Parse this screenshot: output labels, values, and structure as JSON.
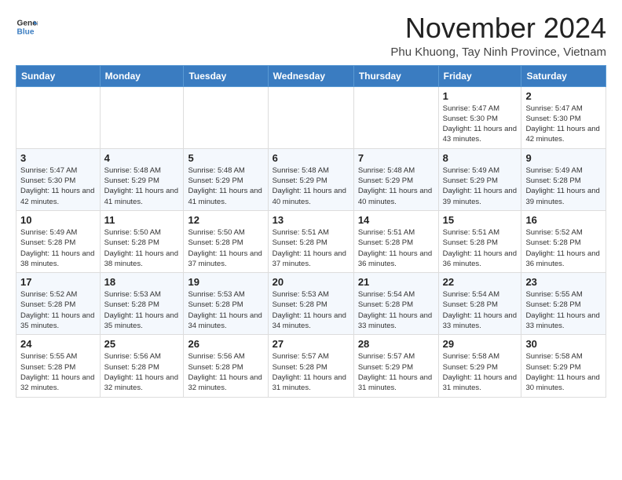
{
  "logo": {
    "line1": "General",
    "line2": "Blue"
  },
  "title": "November 2024",
  "subtitle": "Phu Khuong, Tay Ninh Province, Vietnam",
  "days_of_week": [
    "Sunday",
    "Monday",
    "Tuesday",
    "Wednesday",
    "Thursday",
    "Friday",
    "Saturday"
  ],
  "weeks": [
    [
      {
        "day": "",
        "info": ""
      },
      {
        "day": "",
        "info": ""
      },
      {
        "day": "",
        "info": ""
      },
      {
        "day": "",
        "info": ""
      },
      {
        "day": "",
        "info": ""
      },
      {
        "day": "1",
        "info": "Sunrise: 5:47 AM\nSunset: 5:30 PM\nDaylight: 11 hours and 43 minutes."
      },
      {
        "day": "2",
        "info": "Sunrise: 5:47 AM\nSunset: 5:30 PM\nDaylight: 11 hours and 42 minutes."
      }
    ],
    [
      {
        "day": "3",
        "info": "Sunrise: 5:47 AM\nSunset: 5:30 PM\nDaylight: 11 hours and 42 minutes."
      },
      {
        "day": "4",
        "info": "Sunrise: 5:48 AM\nSunset: 5:29 PM\nDaylight: 11 hours and 41 minutes."
      },
      {
        "day": "5",
        "info": "Sunrise: 5:48 AM\nSunset: 5:29 PM\nDaylight: 11 hours and 41 minutes."
      },
      {
        "day": "6",
        "info": "Sunrise: 5:48 AM\nSunset: 5:29 PM\nDaylight: 11 hours and 40 minutes."
      },
      {
        "day": "7",
        "info": "Sunrise: 5:48 AM\nSunset: 5:29 PM\nDaylight: 11 hours and 40 minutes."
      },
      {
        "day": "8",
        "info": "Sunrise: 5:49 AM\nSunset: 5:29 PM\nDaylight: 11 hours and 39 minutes."
      },
      {
        "day": "9",
        "info": "Sunrise: 5:49 AM\nSunset: 5:28 PM\nDaylight: 11 hours and 39 minutes."
      }
    ],
    [
      {
        "day": "10",
        "info": "Sunrise: 5:49 AM\nSunset: 5:28 PM\nDaylight: 11 hours and 38 minutes."
      },
      {
        "day": "11",
        "info": "Sunrise: 5:50 AM\nSunset: 5:28 PM\nDaylight: 11 hours and 38 minutes."
      },
      {
        "day": "12",
        "info": "Sunrise: 5:50 AM\nSunset: 5:28 PM\nDaylight: 11 hours and 37 minutes."
      },
      {
        "day": "13",
        "info": "Sunrise: 5:51 AM\nSunset: 5:28 PM\nDaylight: 11 hours and 37 minutes."
      },
      {
        "day": "14",
        "info": "Sunrise: 5:51 AM\nSunset: 5:28 PM\nDaylight: 11 hours and 36 minutes."
      },
      {
        "day": "15",
        "info": "Sunrise: 5:51 AM\nSunset: 5:28 PM\nDaylight: 11 hours and 36 minutes."
      },
      {
        "day": "16",
        "info": "Sunrise: 5:52 AM\nSunset: 5:28 PM\nDaylight: 11 hours and 36 minutes."
      }
    ],
    [
      {
        "day": "17",
        "info": "Sunrise: 5:52 AM\nSunset: 5:28 PM\nDaylight: 11 hours and 35 minutes."
      },
      {
        "day": "18",
        "info": "Sunrise: 5:53 AM\nSunset: 5:28 PM\nDaylight: 11 hours and 35 minutes."
      },
      {
        "day": "19",
        "info": "Sunrise: 5:53 AM\nSunset: 5:28 PM\nDaylight: 11 hours and 34 minutes."
      },
      {
        "day": "20",
        "info": "Sunrise: 5:53 AM\nSunset: 5:28 PM\nDaylight: 11 hours and 34 minutes."
      },
      {
        "day": "21",
        "info": "Sunrise: 5:54 AM\nSunset: 5:28 PM\nDaylight: 11 hours and 33 minutes."
      },
      {
        "day": "22",
        "info": "Sunrise: 5:54 AM\nSunset: 5:28 PM\nDaylight: 11 hours and 33 minutes."
      },
      {
        "day": "23",
        "info": "Sunrise: 5:55 AM\nSunset: 5:28 PM\nDaylight: 11 hours and 33 minutes."
      }
    ],
    [
      {
        "day": "24",
        "info": "Sunrise: 5:55 AM\nSunset: 5:28 PM\nDaylight: 11 hours and 32 minutes."
      },
      {
        "day": "25",
        "info": "Sunrise: 5:56 AM\nSunset: 5:28 PM\nDaylight: 11 hours and 32 minutes."
      },
      {
        "day": "26",
        "info": "Sunrise: 5:56 AM\nSunset: 5:28 PM\nDaylight: 11 hours and 32 minutes."
      },
      {
        "day": "27",
        "info": "Sunrise: 5:57 AM\nSunset: 5:28 PM\nDaylight: 11 hours and 31 minutes."
      },
      {
        "day": "28",
        "info": "Sunrise: 5:57 AM\nSunset: 5:29 PM\nDaylight: 11 hours and 31 minutes."
      },
      {
        "day": "29",
        "info": "Sunrise: 5:58 AM\nSunset: 5:29 PM\nDaylight: 11 hours and 31 minutes."
      },
      {
        "day": "30",
        "info": "Sunrise: 5:58 AM\nSunset: 5:29 PM\nDaylight: 11 hours and 30 minutes."
      }
    ]
  ]
}
